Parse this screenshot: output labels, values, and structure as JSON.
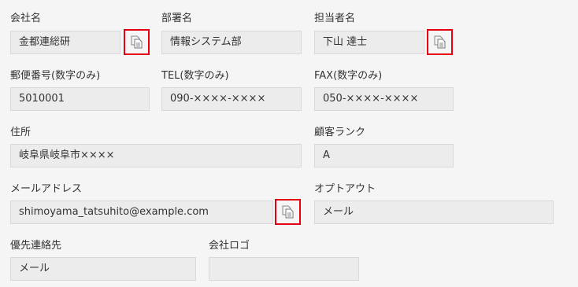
{
  "fields": {
    "company_name": {
      "label": "会社名",
      "value": "金都連総研"
    },
    "department": {
      "label": "部署名",
      "value": "情報システム部"
    },
    "contact_person": {
      "label": "担当者名",
      "value": "下山 達士"
    },
    "postal_code": {
      "label": "郵便番号(数字のみ)",
      "value": "5010001"
    },
    "tel": {
      "label": "TEL(数字のみ)",
      "value": "090-××××-××××"
    },
    "fax": {
      "label": "FAX(数字のみ)",
      "value": "050-××××-××××"
    },
    "address": {
      "label": "住所",
      "value": "岐阜県岐阜市××××"
    },
    "customer_rank": {
      "label": "顧客ランク",
      "value": "A"
    },
    "email": {
      "label": "メールアドレス",
      "value": "shimoyama_tatsuhito@example.com"
    },
    "opt_out": {
      "label": "オプトアウト",
      "value": "メール"
    },
    "preferred_contact": {
      "label": "優先連絡先",
      "value": "メール"
    },
    "company_logo": {
      "label": "会社ロゴ",
      "value": ""
    }
  },
  "icons": {
    "copy_icon": "copy-to-clipboard-icon",
    "highlight_color": "#e60012"
  }
}
